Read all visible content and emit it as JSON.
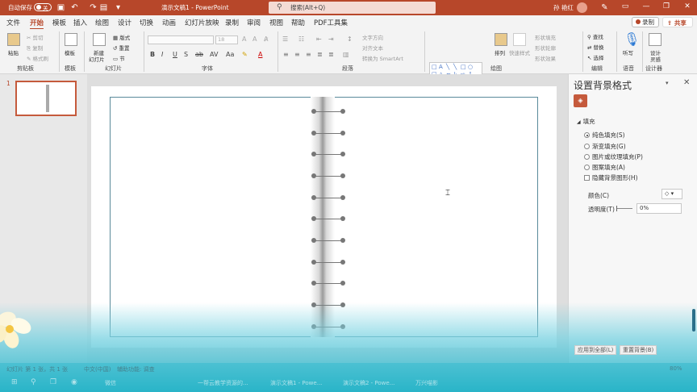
{
  "titlebar": {
    "autosave_label": "自动保存",
    "autosave_state": "关",
    "doc_title": "演示文稿1  -  PowerPoint",
    "search_placeholder": "搜索(Alt+Q)",
    "user_name": "孙 艳红"
  },
  "menu": {
    "items": [
      "文件",
      "开始",
      "模板",
      "插入",
      "绘图",
      "设计",
      "切换",
      "动画",
      "幻灯片放映",
      "录制",
      "审阅",
      "视图",
      "帮助",
      "PDF工具集"
    ],
    "active_index": 1,
    "record_label": "录制",
    "share_label": "共享"
  },
  "ribbon": {
    "groups": [
      "剪贴板",
      "模板",
      "幻灯片",
      "字体",
      "段落",
      "绘图",
      "编辑",
      "语音",
      "设计器"
    ],
    "clipboard": {
      "paste": "粘贴",
      "cut": "剪切",
      "copy": "复制",
      "format_painter": "格式刷"
    },
    "template": {
      "template": "模板"
    },
    "slides": {
      "new_slide": "新建",
      "new_slide2": "幻灯片",
      "layout": "版式",
      "reset": "重置",
      "section": "节"
    },
    "font": {
      "size": "18"
    },
    "paragraph": {
      "text_direction": "文字方向",
      "align_text": "对齐文本",
      "smartart": "转换为 SmartArt"
    },
    "drawing": {
      "arrange": "排列",
      "quick_styles": "快速样式",
      "shape_fill": "形状填充",
      "shape_outline": "形状轮廓",
      "shape_effects": "形状效果"
    },
    "editing": {
      "find": "查找",
      "replace": "替换",
      "select": "选择"
    },
    "voice": {
      "dictate": "听写"
    },
    "designer": {
      "designer": "设计",
      "designer2": "灵感"
    }
  },
  "slides_panel": {
    "slide_number": "1"
  },
  "format_panel": {
    "title": "设置背景格式",
    "section": "填充",
    "options": [
      {
        "label": "纯色填充(S)",
        "selected": true
      },
      {
        "label": "渐变填充(G)",
        "selected": false
      },
      {
        "label": "图片或纹理填充(P)",
        "selected": false
      },
      {
        "label": "图案填充(A)",
        "selected": false
      }
    ],
    "hide_graphics": "隐藏背景图形(H)",
    "color_label": "颜色(C)",
    "transparency_label": "透明度(T)",
    "transparency_value": "0%",
    "apply_all": "应用到全部(L)",
    "reset": "重置背景(B)"
  },
  "statusbar": {
    "slide_info": "幻灯片 第 1 张，共 1 张",
    "lang": "中文(中国)",
    "accessibility": "辅助功能: 调查",
    "zoom": "80%"
  },
  "taskbar": {
    "apps": [
      "微信",
      "一帮云教学资源的...",
      "演示文稿1 - Powe...",
      "演示文稿2 - Powe...",
      "万兴喵影"
    ]
  },
  "colors": {
    "accent": "#b7472a",
    "panel_bg": "#f7f7f7",
    "water": "#3fb8c9"
  }
}
